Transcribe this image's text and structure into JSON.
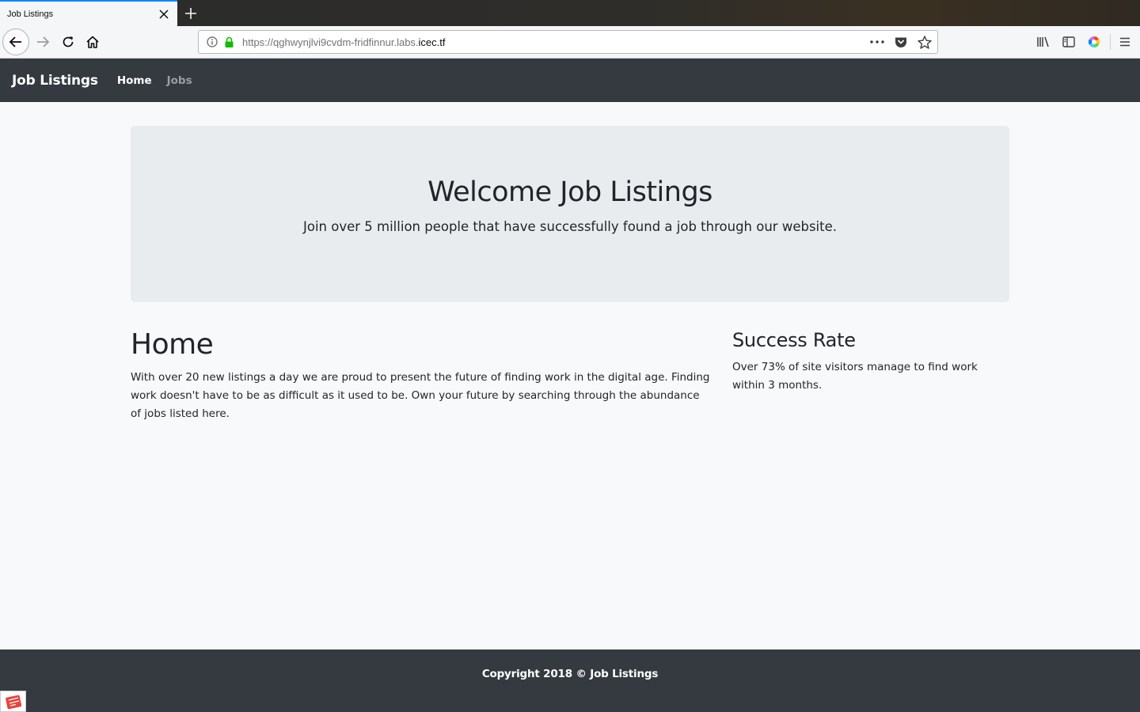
{
  "browser": {
    "tab": {
      "title": "Job Listings"
    },
    "url": {
      "prefix": "https://qghwynjlvi9cvdm-fridfinnur.labs.",
      "domain": "icec.tf"
    }
  },
  "site": {
    "brand": "Job Listings",
    "nav": [
      {
        "label": "Home",
        "active": true
      },
      {
        "label": "Jobs",
        "active": false
      }
    ]
  },
  "jumbotron": {
    "title": "Welcome Job Listings",
    "lead": "Join over 5 million people that have successfully found a job through our website."
  },
  "home": {
    "heading": "Home",
    "text": "With over 20 new listings a day we are proud to present the future of finding work in the digital age. Finding work doesn't have to be as difficult as it used to be. Own your future by searching through the abundance of jobs listed here."
  },
  "success": {
    "heading": "Success Rate",
    "text": "Over 73% of site visitors manage to find work within 3 months."
  },
  "footer": {
    "text": "Copyright 2018 © Job Listings"
  },
  "colors": {
    "navbar": "#343a40",
    "jumbotron": "#e9ecef",
    "page_bg": "#f8f9fa",
    "tab_accent": "#0a84ff",
    "lock_green": "#12bc00"
  }
}
